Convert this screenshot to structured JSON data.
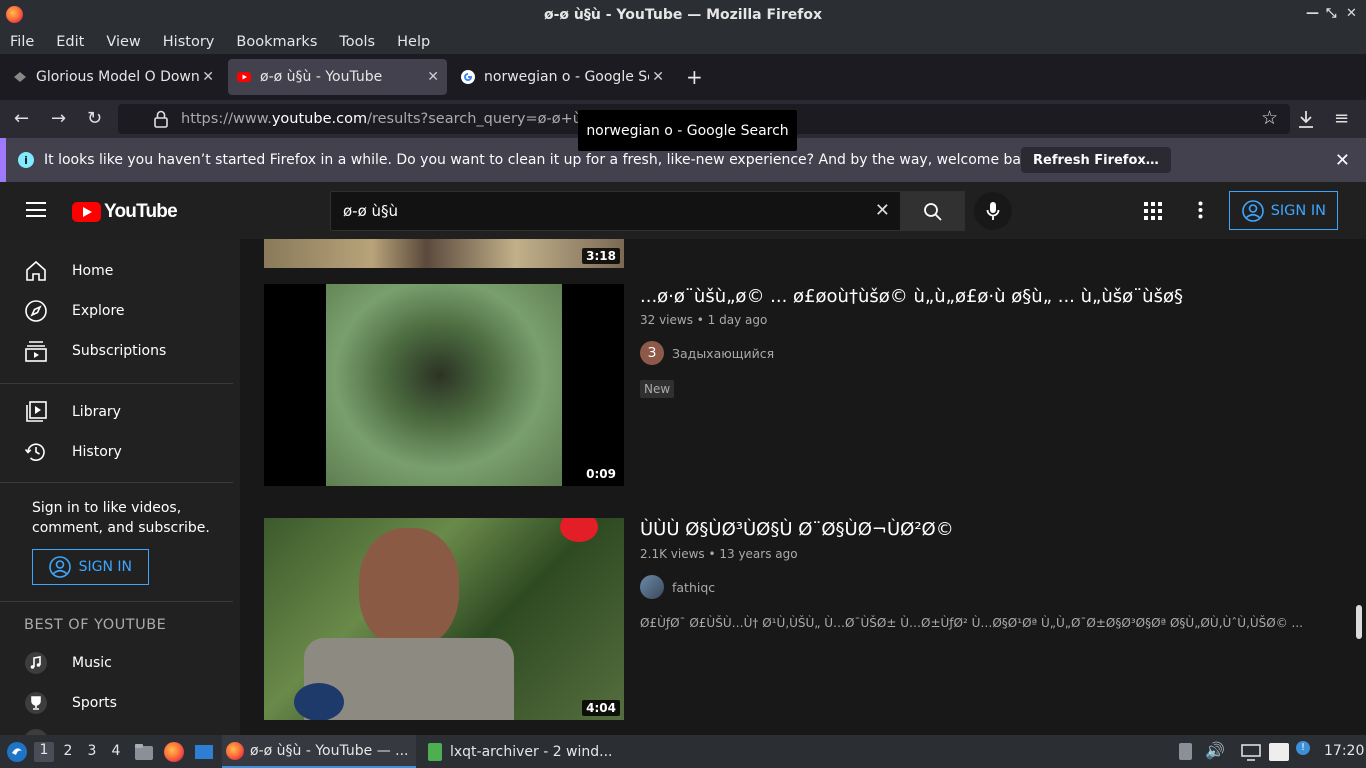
{
  "window": {
    "title": "ø-ø ù§ù - YouTube — Mozilla Firefox"
  },
  "menu": [
    "File",
    "Edit",
    "View",
    "History",
    "Bookmarks",
    "Tools",
    "Help"
  ],
  "tabs": [
    {
      "title": "Glorious Model O Downlo",
      "icon": "generic-favicon-icon"
    },
    {
      "title": "ø-ø ù§ù - YouTube",
      "icon": "youtube-favicon-icon",
      "active": true
    },
    {
      "title": "norwegian o - Google Se",
      "icon": "google-favicon-icon"
    }
  ],
  "url": {
    "prefix": "https://www.",
    "domain": "youtube.com",
    "path": "/results?search_query=ø-ø+ù§ù"
  },
  "tooltip": "norwegian o - Google Search",
  "notice": {
    "text": "It looks like you haven’t started Firefox in a while. Do you want to clean it up for a fresh, like-new experience? And by the way, welcome back!",
    "button": "Refresh Firefox…"
  },
  "yt": {
    "logo_text": "YouTube",
    "search_value": "ø-ø ù§ù",
    "sign_in": "SIGN IN"
  },
  "sidebar": {
    "items": [
      "Home",
      "Explore",
      "Subscriptions",
      "Library",
      "History"
    ],
    "prompt": "Sign in to like videos, comment, and subscribe.",
    "sign_in": "SIGN IN",
    "best_heading": "BEST OF YOUTUBE",
    "best_items": [
      "Music",
      "Sports"
    ]
  },
  "videos": [
    {
      "duration": "3:18"
    },
    {
      "title": "...ø·ø¨ùšù„ø© ... ø£øoù†ùšø© ù„ù„ø£ø·ù ø§ù„ ... ù„ùšø¨ùšø§",
      "meta": "32 views • 1 day ago",
      "channel": "Задыхающийся",
      "channel_initial": "З",
      "badge": "New",
      "duration": "0:09"
    },
    {
      "title": "ÙÙÙ Ø§ÙØ³ÙØ§Ù Ø¨Ø§ÙØ¬ÙØ²Ø©",
      "meta": "2.1K views • 13 years ago",
      "channel": "fathiqc",
      "desc": "Ø£ÙƒØ¯ Ø£ÙŠÙ…Ù† Ø¹Ù‚ÙŠÙ„ Ù…Ø¯ÙŠØ± Ù…Ø±ÙƒØ² Ù…Ø§Ø¹Øª Ù„Ù„Ø¯Ø±Ø§Ø³Ø§Øª Ø§Ù„ØÙ‚ÙˆÙ‚ÙŠØ© ...",
      "duration": "4:04"
    }
  ],
  "taskbar": {
    "workspaces": [
      "1",
      "2",
      "3",
      "4"
    ],
    "windows": [
      "ø-ø ù§ù - YouTube — ...",
      "lxqt-archiver - 2 wind..."
    ],
    "clock": "17:20"
  }
}
